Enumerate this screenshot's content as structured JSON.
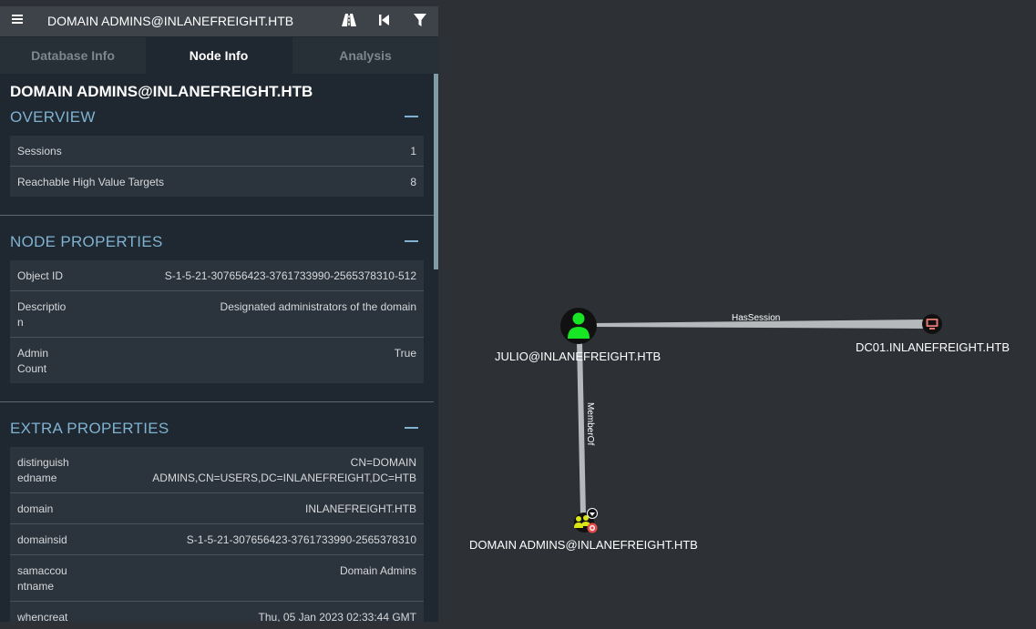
{
  "search": {
    "title": "DOMAIN ADMINS@INLANEFREIGHT.HTB"
  },
  "toolbar": {
    "menu_icon": "hamburger-icon",
    "path_icon": "road-icon",
    "back_icon": "back-icon",
    "filter_icon": "filter-icon"
  },
  "tabs": [
    {
      "label": "Database Info",
      "active": false
    },
    {
      "label": "Node Info",
      "active": true
    },
    {
      "label": "Analysis",
      "active": false
    }
  ],
  "node_title": "DOMAIN ADMINS@INLANEFREIGHT.HTB",
  "overview": {
    "title": "OVERVIEW",
    "rows": [
      {
        "key": "Sessions",
        "value": "1"
      },
      {
        "key": "Reachable High Value Targets",
        "value": "8"
      }
    ]
  },
  "node_properties": {
    "title": "NODE PROPERTIES",
    "rows": [
      {
        "key": "Object ID",
        "value": "S-1-5-21-307656423-3761733990-2565378310-512"
      },
      {
        "key1": "Descriptio",
        "key2": "n",
        "value": "Designated administrators of the domain"
      },
      {
        "key1": "Admin",
        "key2": "Count",
        "value": "True"
      }
    ]
  },
  "extra_properties": {
    "title": "EXTRA PROPERTIES",
    "rows": [
      {
        "key1": "distinguish",
        "key2": "edname",
        "value1": "CN=DOMAIN",
        "value2": "ADMINS,CN=USERS,DC=INLANEFREIGHT,DC=HTB"
      },
      {
        "key": "domain",
        "value": "INLANEFREIGHT.HTB"
      },
      {
        "key": "domainsid",
        "value": "S-1-5-21-307656423-3761733990-2565378310"
      },
      {
        "key1": "samaccou",
        "key2": "ntname",
        "value": "Domain Admins"
      },
      {
        "key": "whencreat",
        "value": "Thu, 05 Jan 2023 02:33:44 GMT"
      }
    ]
  },
  "graph": {
    "nodes": [
      {
        "label": "JULIO@INLANEFREIGHT.HTB",
        "type": "user",
        "color": "#17e625"
      },
      {
        "label": "DC01.INLANEFREIGHT.HTB",
        "type": "computer",
        "color": "#e67873"
      },
      {
        "label": "DOMAIN ADMINS@INLANEFREIGHT.HTB",
        "type": "group",
        "color": "#dbe617"
      }
    ],
    "edges": [
      {
        "label": "HasSession",
        "from": "JULIO@INLANEFREIGHT.HTB",
        "to": "DC01.INLANEFREIGHT.HTB"
      },
      {
        "label": "MemberOf",
        "from": "JULIO@INLANEFREIGHT.HTB",
        "to": "DOMAIN ADMINS@INLANEFREIGHT.HTB"
      }
    ]
  },
  "colors": {
    "panel_bg": "#1f2730",
    "accent": "#7fb3d1",
    "canvas_bg": "#2d3035"
  }
}
